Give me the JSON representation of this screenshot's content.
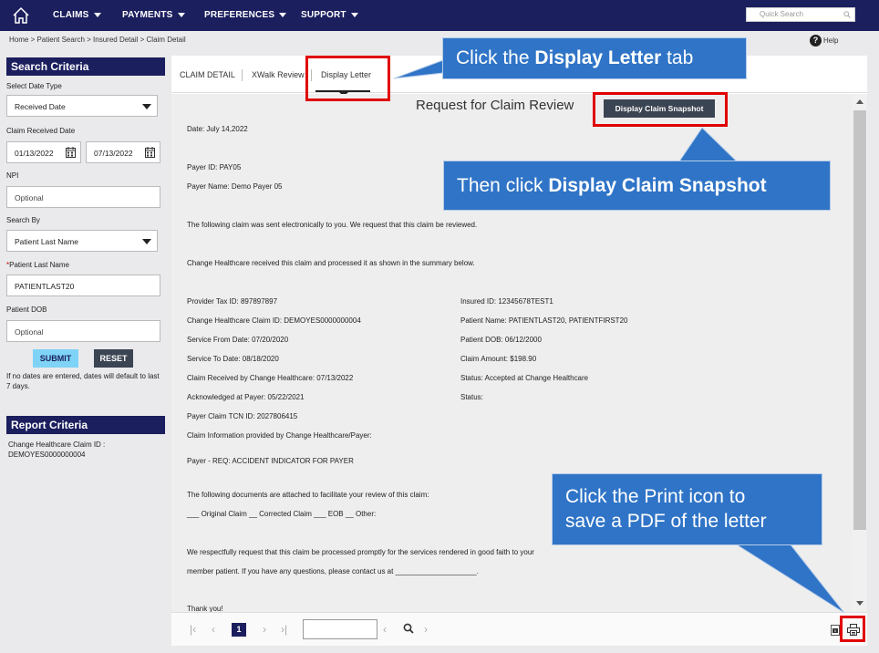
{
  "nav": {
    "items": [
      "CLAIMS",
      "PAYMENTS",
      "PREFERENCES",
      "SUPPORT"
    ],
    "quick_search_placeholder": "Quick Search"
  },
  "breadcrumb": "Home > Patient Search > Insured Detail > Claim Detail",
  "help_label": "Help",
  "search_criteria": {
    "title": "Search Criteria",
    "date_type_label": "Select Date Type",
    "date_type_value": "Received Date",
    "claim_received_label": "Claim Received Date",
    "date_from": "01/13/2022",
    "date_to": "07/13/2022",
    "npi_label": "NPI",
    "npi_placeholder": "Optional",
    "search_by_label": "Search By",
    "search_by_value": "Patient Last Name",
    "patient_last_name_label": "Patient Last  Name",
    "patient_last_name_value": "PATIENTLAST20",
    "patient_dob_label": "Patient DOB",
    "patient_dob_placeholder": "Optional",
    "submit_label": "SUBMIT",
    "reset_label": "RESET",
    "note": "If no dates are entered, dates will default to last 7 days."
  },
  "report_criteria": {
    "title": "Report Criteria",
    "claim_id_label": "Change Healthcare Claim ID :",
    "claim_id_value": "DEMOYES0000000004"
  },
  "tabs": [
    "CLAIM DETAIL",
    "XWalk Review",
    "Display Letter"
  ],
  "letter": {
    "title": "Request for Claim Review",
    "snapshot_button": "Display Claim Snapshot",
    "date": "Date: July 14,2022",
    "payer_id": "Payer ID: PAY05",
    "payer_name": "Payer Name: Demo Payer 05",
    "intro": "The following claim was sent electronically to you. We request that this claim be reviewed.",
    "received": "Change Healthcare received this claim and processed it as shown in the summary below.",
    "left_fields": [
      "Provider Tax ID: 897897897",
      "Change Healthcare Claim ID: DEMOYES0000000004",
      "Service From Date: 07/20/2020",
      "Service To Date: 08/18/2020",
      "Claim Received by Change Healthcare: 07/13/2022",
      "Acknowledged at Payer: 05/22/2021",
      "Payer Claim TCN ID: 2027806415",
      "Claim Information provided by Change Healthcare/Payer:"
    ],
    "right_fields": [
      "Insured ID: 12345678TEST1",
      "Patient Name: PATIENTLAST20, PATIENTFIRST20",
      "Patient DOB: 06/12/2000",
      "Claim Amount: $198.90",
      "Status: Accepted at Change Healthcare",
      "Status:"
    ],
    "req_line": "Payer - REQ: ACCIDENT INDICATOR FOR PAYER",
    "docs_line": "The following documents are attached to facilitate your review of this claim:",
    "docs_options": "___ Original Claim __ Corrected Claim ___ EOB __ Other:",
    "request_line1": "We respectfully request that this claim be processed promptly for the services rendered in good faith to your",
    "request_line2": "member patient. If you have any questions, please contact us at ____________________.",
    "thanks": "Thank you!"
  },
  "pager": {
    "current_page": "1"
  },
  "callouts": {
    "tab_prefix": "Click the ",
    "tab_bold": "Display Letter",
    "tab_suffix": " tab",
    "snapshot_prefix": "Then click ",
    "snapshot_bold": "Display Claim Snapshot",
    "print_line1": "Click the Print icon to",
    "print_line2": "save a PDF of the letter"
  },
  "colors": {
    "nav_bg": "#1b1f5e",
    "callout_bg": "#2f74c7",
    "highlight": "#e00000",
    "submit_bg": "#7ed3f7",
    "dark_button": "#3b4452"
  }
}
